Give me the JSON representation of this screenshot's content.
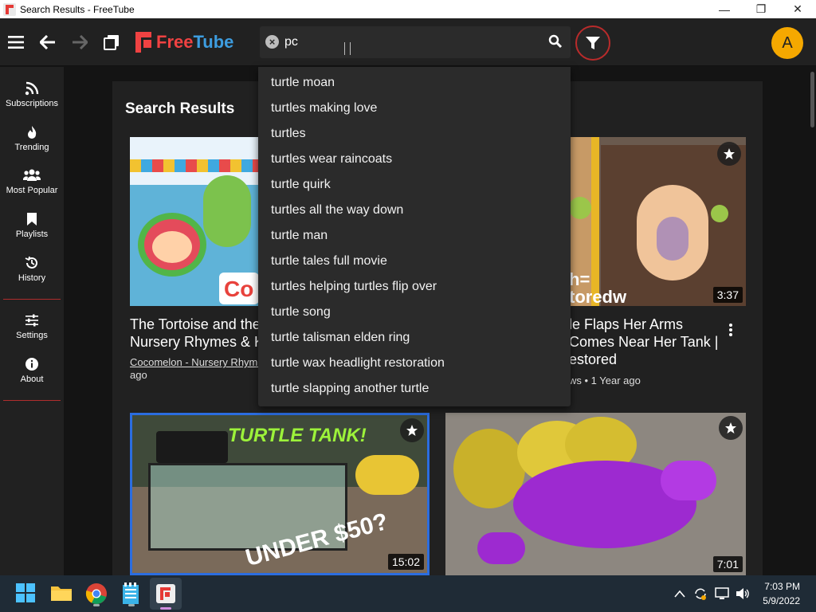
{
  "window": {
    "title": "Search Results - FreeTube",
    "minimize": "—",
    "maximize": "❐",
    "close": "✕"
  },
  "topbar": {
    "logo_free": "Free",
    "logo_tube": "Tube",
    "search_value": "pc",
    "avatar_letter": "A"
  },
  "sidebar": {
    "items": [
      {
        "label": "Subscriptions",
        "icon": "rss-icon"
      },
      {
        "label": "Trending",
        "icon": "fire-icon"
      },
      {
        "label": "Most Popular",
        "icon": "users-icon"
      },
      {
        "label": "Playlists",
        "icon": "bookmark-icon"
      },
      {
        "label": "History",
        "icon": "history-icon"
      },
      {
        "label": "Settings",
        "icon": "sliders-icon"
      },
      {
        "label": "About",
        "icon": "info-icon"
      }
    ]
  },
  "main": {
    "heading": "Search Results",
    "videos": [
      {
        "title_line1": "The Tortoise and the",
        "title_line2": "Nursery Rhymes & K",
        "channel": "Cocomelon - Nursery Rhyme",
        "meta_line2": "ago"
      },
      {
        "title_line1": "le Flaps Her Arms",
        "title_line2": "Comes Near Her Tank |",
        "title_line3": "estored",
        "meta": "ws • 1 Year ago",
        "duration": "3:37",
        "thumb_text": "h=\ntoredw"
      },
      {
        "duration": "15:02",
        "thumb_text_top": "TURTLE TANK!",
        "thumb_text_bottom": "UNDER $50?"
      },
      {
        "duration": "7:01"
      }
    ]
  },
  "suggestions": [
    "turtle moan",
    "turtles making love",
    "turtles",
    "turtles wear raincoats",
    "turtle quirk",
    "turtles all the way down",
    "turtle man",
    "turtle tales full movie",
    "turtles helping turtles flip over",
    "turtle song",
    "turtle talisman elden ring",
    "turtle wax headlight restoration",
    "turtle slapping another turtle"
  ],
  "taskbar": {
    "time": "7:03 PM",
    "date": "5/9/2022"
  },
  "colors": {
    "accent_red": "#f04242",
    "accent_blue": "#3d9de0",
    "avatar_bg": "#f5a800",
    "surface": "#212121",
    "background": "#141414"
  }
}
